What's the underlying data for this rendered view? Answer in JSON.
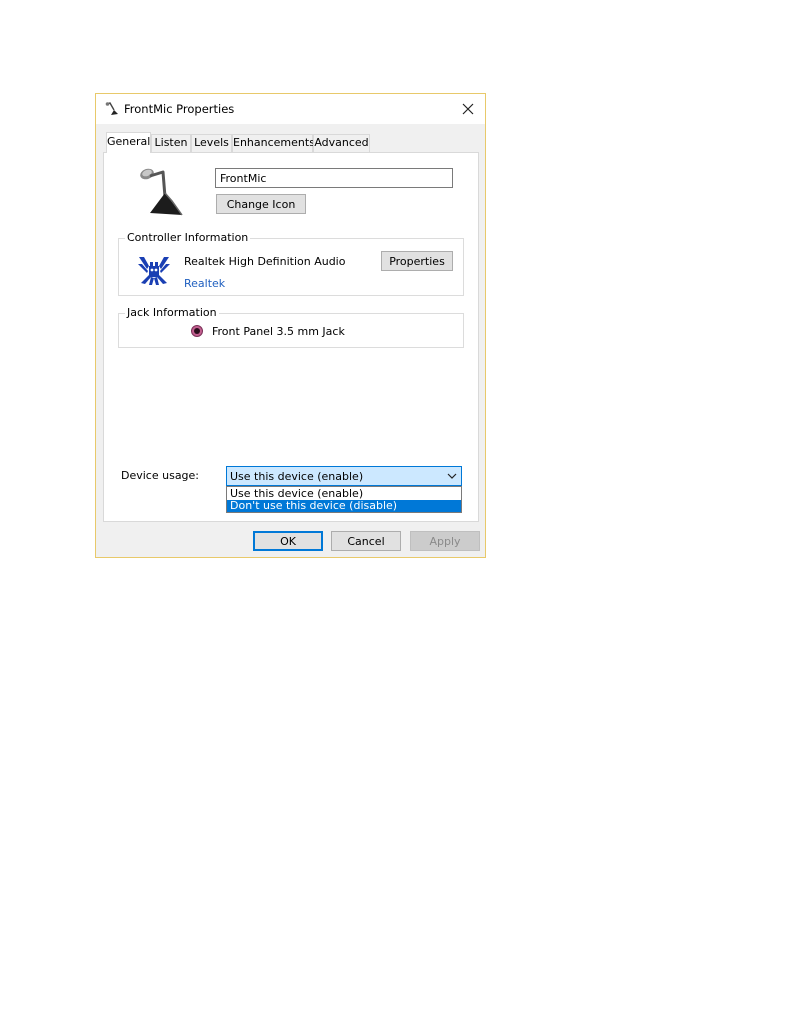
{
  "window": {
    "title": "FrontMic Properties"
  },
  "tabs": [
    {
      "label": "General",
      "active": true
    },
    {
      "label": "Listen",
      "active": false
    },
    {
      "label": "Levels",
      "active": false
    },
    {
      "label": "Enhancements",
      "active": false
    },
    {
      "label": "Advanced",
      "active": false
    }
  ],
  "general": {
    "device_icon": "microphone-icon",
    "device_name_value": "FrontMic",
    "change_icon_label": "Change Icon",
    "controller": {
      "group_label": "Controller Information",
      "logo_icon": "realtek-crab-icon",
      "name": "Realtek High Definition Audio",
      "vendor_link": "Realtek",
      "properties_label": "Properties"
    },
    "jack": {
      "group_label": "Jack Information",
      "jack_color": "#c25f8f",
      "description": "Front Panel 3.5 mm Jack"
    },
    "device_usage": {
      "label": "Device usage:",
      "selected_value": "Use this device (enable)",
      "options": [
        {
          "label": "Use this device (enable)",
          "highlighted": false
        },
        {
          "label": "Don't use this device (disable)",
          "highlighted": true
        }
      ]
    }
  },
  "footer": {
    "ok_label": "OK",
    "cancel_label": "Cancel",
    "apply_label": "Apply",
    "apply_enabled": false
  },
  "colors": {
    "accent": "#0078d7",
    "window_border": "#e8c96a",
    "link": "#1f5fbf"
  }
}
